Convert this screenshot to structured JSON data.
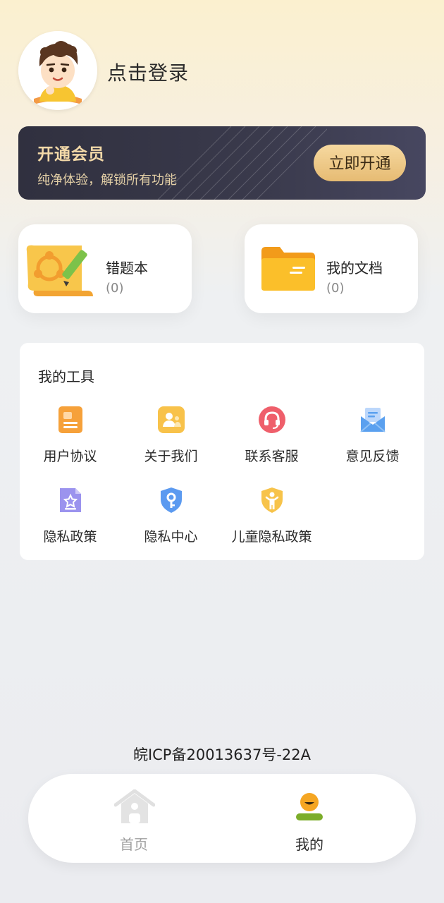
{
  "header": {
    "login_text": "点击登录"
  },
  "vip": {
    "title": "开通会员",
    "subtitle": "纯净体验，解锁所有功能",
    "button_label": "立即开通"
  },
  "cards": [
    {
      "title": "错题本",
      "count": "(0)",
      "icon": "scroll-pencil-icon"
    },
    {
      "title": "我的文档",
      "count": "(0)",
      "icon": "folder-icon"
    }
  ],
  "tools": {
    "title": "我的工具",
    "items": [
      {
        "label": "用户协议",
        "icon": "document-icon",
        "color": "#f6a13a"
      },
      {
        "label": "关于我们",
        "icon": "people-icon",
        "color": "#f8c24a"
      },
      {
        "label": "联系客服",
        "icon": "headset-icon",
        "color": "#ef5f6b"
      },
      {
        "label": "意见反馈",
        "icon": "mail-icon",
        "color": "#5aa0ef"
      },
      {
        "label": "隐私政策",
        "icon": "privacy-doc-icon",
        "color": "#9b93ee"
      },
      {
        "label": "隐私中心",
        "icon": "shield-key-icon",
        "color": "#5b9af0"
      },
      {
        "label": "儿童隐私政策",
        "icon": "child-shield-icon",
        "color": "#f7c34a"
      }
    ]
  },
  "footer": {
    "icp": "皖ICP备20013637号-22A"
  },
  "tabbar": {
    "tabs": [
      {
        "label": "首页",
        "icon": "home-icon",
        "active": false
      },
      {
        "label": "我的",
        "icon": "profile-icon",
        "active": true
      }
    ],
    "inactive_color": "#a0a0a0",
    "active_color": "#2b2b2b"
  }
}
